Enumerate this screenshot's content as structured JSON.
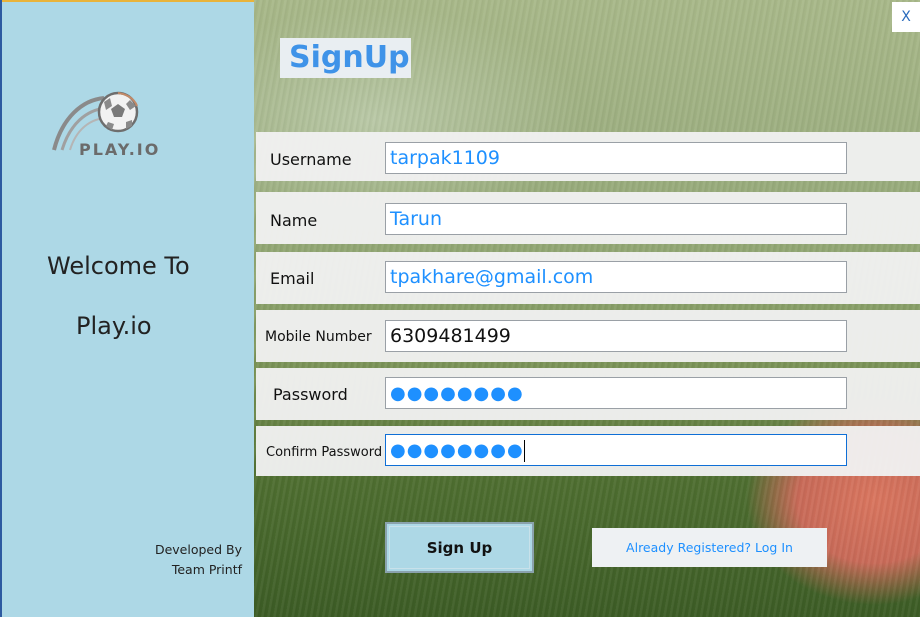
{
  "left_panel": {
    "logo_text": "PLAY.IO",
    "welcome_line1": "Welcome To",
    "welcome_line2": "Play.io",
    "developer_line1": "Developed By",
    "developer_line2": "Team Printf"
  },
  "window": {
    "close_label": "X"
  },
  "form": {
    "title": "SignUp",
    "username": {
      "label": "Username",
      "value": "tarpak1109"
    },
    "name": {
      "label": "Name",
      "value": "Tarun"
    },
    "email": {
      "label": "Email",
      "value": "tpakhare@gmail.com"
    },
    "mobile": {
      "label": "Mobile Number",
      "value": "6309481499"
    },
    "password": {
      "label": "Password",
      "masked_value": "●●●●●●●●"
    },
    "confirm_password": {
      "label": "Confirm Password",
      "masked_value": "●●●●●●●●"
    },
    "signup_button": "Sign Up",
    "login_link": "Already Registered? Log In"
  },
  "colors": {
    "left_panel_bg": "#add8e6",
    "accent_blue": "#1e90ff",
    "title_blue": "#3f93e8"
  },
  "icons": {
    "logo": "soccer-ball-icon"
  }
}
